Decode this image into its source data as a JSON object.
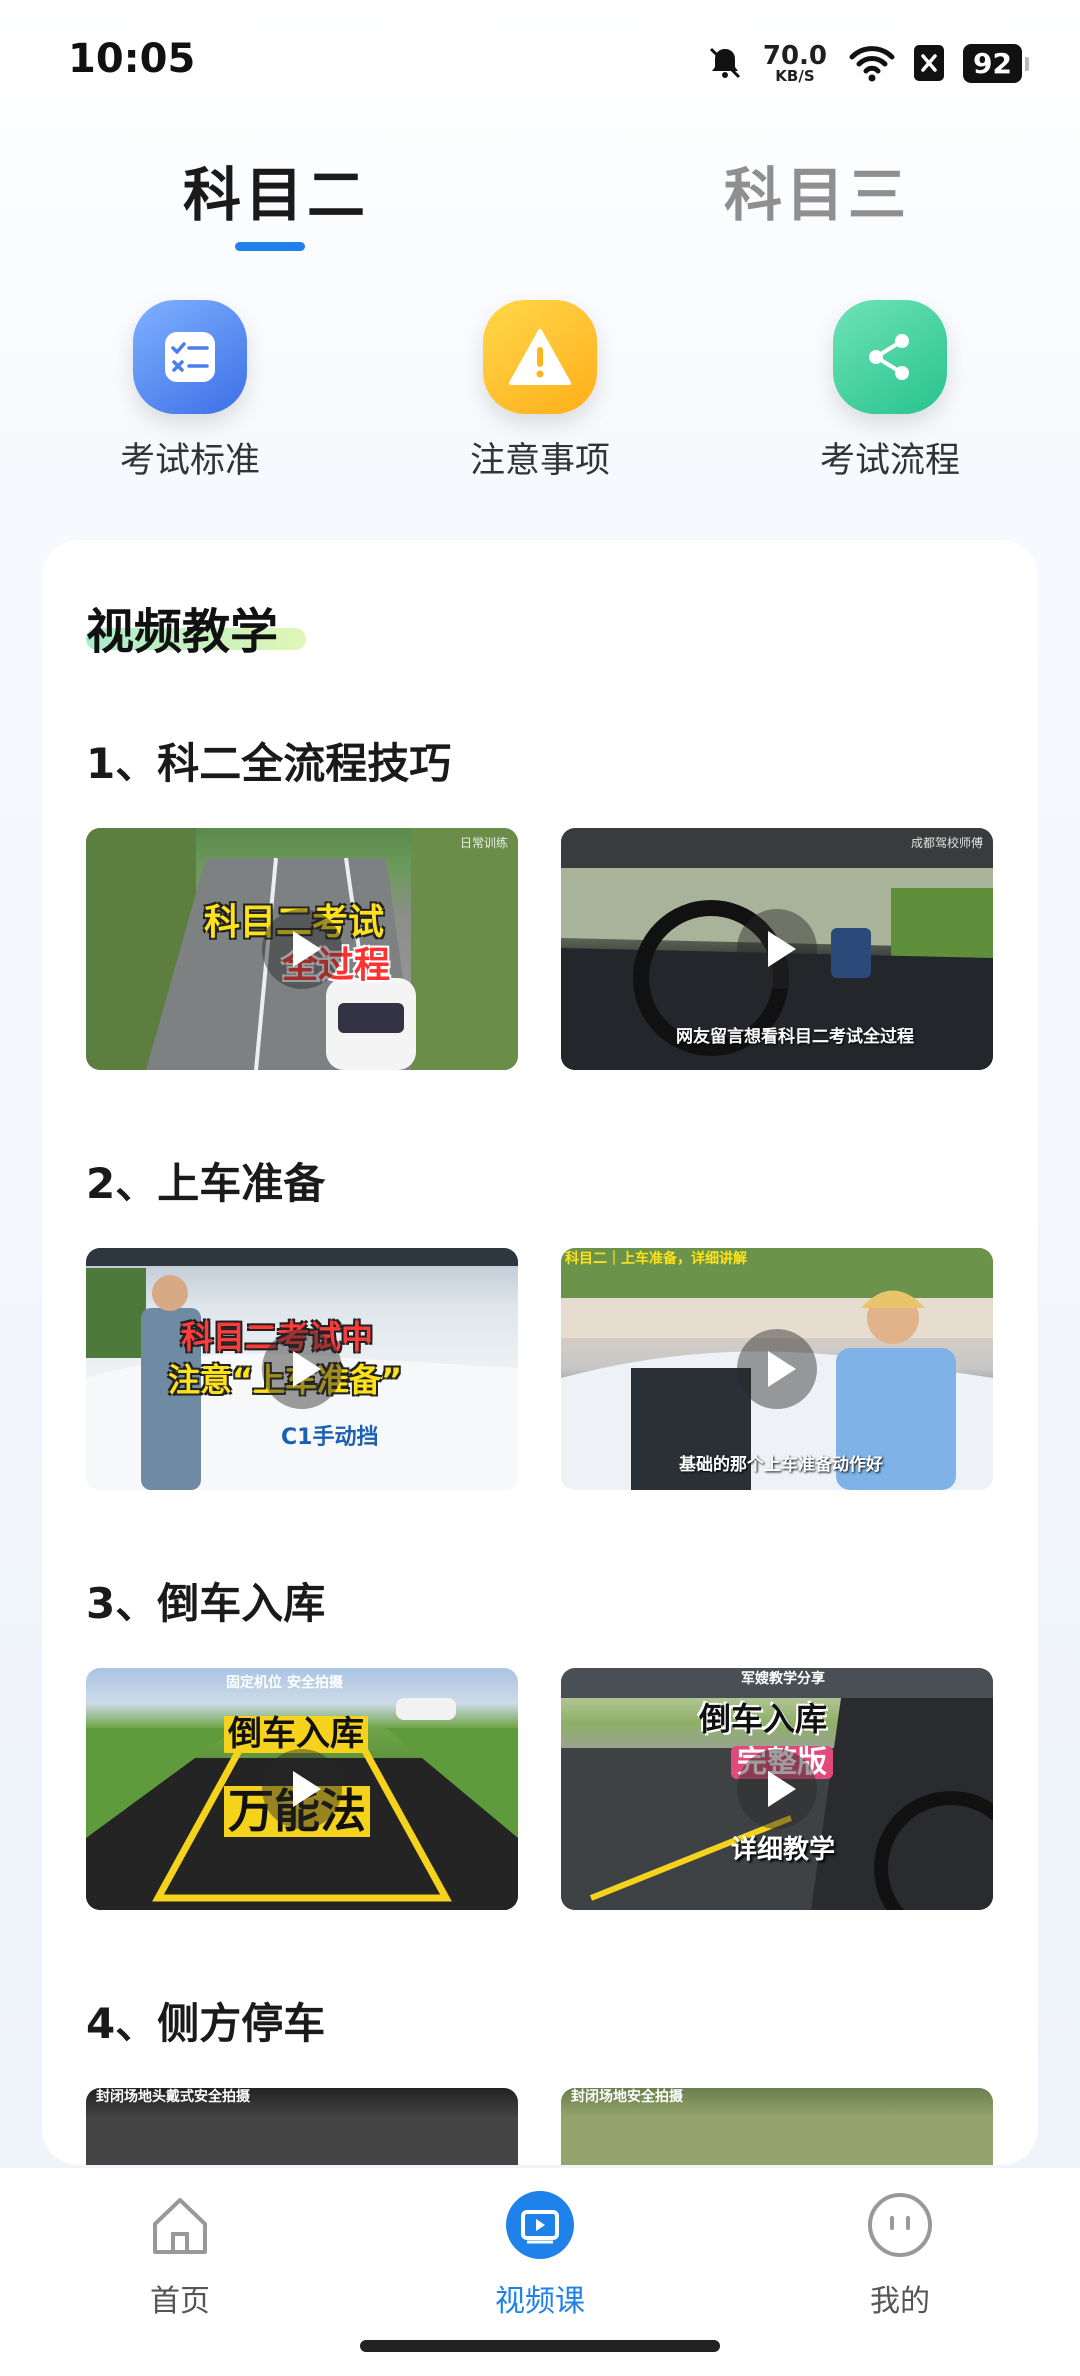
{
  "status_bar": {
    "time": "10:05",
    "net_speed": "70.0",
    "net_unit": "KB/S",
    "battery": "92"
  },
  "tabs": [
    {
      "label": "科目二",
      "active": true
    },
    {
      "label": "科目三",
      "active": false
    }
  ],
  "quick_actions": [
    {
      "label": "考试标准",
      "icon": "checklist-icon"
    },
    {
      "label": "注意事项",
      "icon": "warning-icon"
    },
    {
      "label": "考试流程",
      "icon": "share-flow-icon"
    }
  ],
  "card": {
    "title": "视频教学",
    "sections": [
      {
        "title": "1、科二全流程技巧",
        "videos": [
          {
            "caption_top": "科目二考试",
            "caption_bottom": "全过程",
            "tag": "日常训练"
          },
          {
            "caption_sub": "网友留言想看科目二考试全过程",
            "tag": "成都驾校师傅"
          }
        ]
      },
      {
        "title": "2、上车准备",
        "videos": [
          {
            "caption_top": "科目二考试中",
            "caption_mid": "注意“上车准备”",
            "caption_bottom": "C1手动挡"
          },
          {
            "caption_head": "科目二｜上车准备，详细讲解",
            "caption_sub": "基础的那个上车准备动作好"
          }
        ]
      },
      {
        "title": "3、倒车入库",
        "videos": [
          {
            "caption_head": "固定机位 安全拍摄",
            "caption_top": "倒车入库",
            "caption_bottom": "万能法"
          },
          {
            "caption_head": "军嫂教学分享",
            "caption_top": "倒车入库",
            "caption_mid": "完整版",
            "caption_bottom": "详细教学"
          }
        ]
      },
      {
        "title": "4、侧方停车",
        "videos": [
          {
            "caption_head": "封闭场地头戴式安全拍摄"
          },
          {
            "caption_head": "封闭场地安全拍摄"
          }
        ]
      }
    ]
  },
  "bottom_nav": [
    {
      "label": "首页",
      "active": false
    },
    {
      "label": "视频课",
      "active": true
    },
    {
      "label": "我的",
      "active": false
    }
  ],
  "colors": {
    "accent": "#1e82ea",
    "tab_inactive": "#8f8f8f"
  }
}
